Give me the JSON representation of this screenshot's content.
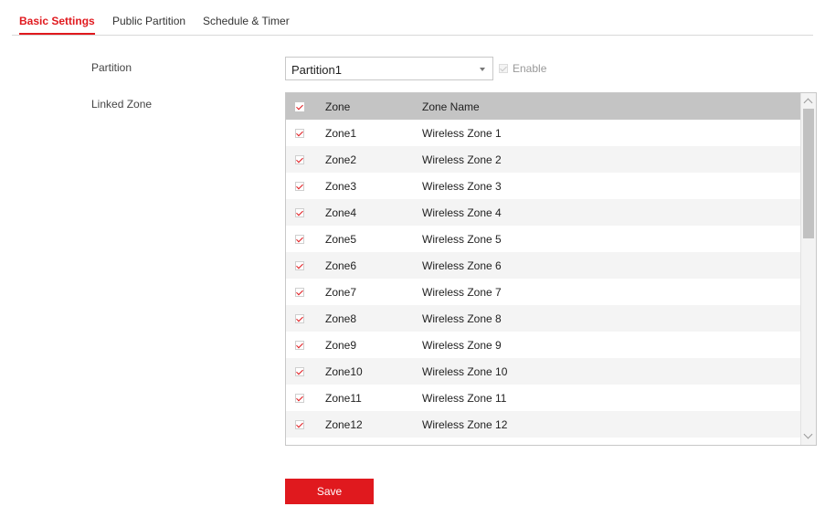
{
  "tabs": [
    {
      "label": "Basic Settings",
      "active": true
    },
    {
      "label": "Public Partition",
      "active": false
    },
    {
      "label": "Schedule & Timer",
      "active": false
    }
  ],
  "form": {
    "partition_label": "Partition",
    "partition_value": "Partition1",
    "enable_label": "Enable",
    "enable_checked": true,
    "enable_disabled": true,
    "linked_zone_label": "Linked Zone"
  },
  "table": {
    "header": {
      "zone": "Zone",
      "zone_name": "Zone Name",
      "all_checked": true
    },
    "rows": [
      {
        "zone": "Zone1",
        "name": "Wireless Zone 1",
        "checked": true
      },
      {
        "zone": "Zone2",
        "name": "Wireless Zone 2",
        "checked": true
      },
      {
        "zone": "Zone3",
        "name": "Wireless Zone 3",
        "checked": true
      },
      {
        "zone": "Zone4",
        "name": "Wireless Zone 4",
        "checked": true
      },
      {
        "zone": "Zone5",
        "name": "Wireless Zone 5",
        "checked": true
      },
      {
        "zone": "Zone6",
        "name": "Wireless Zone 6",
        "checked": true
      },
      {
        "zone": "Zone7",
        "name": "Wireless Zone 7",
        "checked": true
      },
      {
        "zone": "Zone8",
        "name": "Wireless Zone 8",
        "checked": true
      },
      {
        "zone": "Zone9",
        "name": "Wireless Zone 9",
        "checked": true
      },
      {
        "zone": "Zone10",
        "name": "Wireless Zone 10",
        "checked": true
      },
      {
        "zone": "Zone11",
        "name": "Wireless Zone 11",
        "checked": true
      },
      {
        "zone": "Zone12",
        "name": "Wireless Zone 12",
        "checked": true
      },
      {
        "zone": "",
        "name": "",
        "checked": false
      }
    ]
  },
  "save_label": "Save",
  "colors": {
    "accent": "#e0191e",
    "header_bg": "#c4c4c4"
  }
}
